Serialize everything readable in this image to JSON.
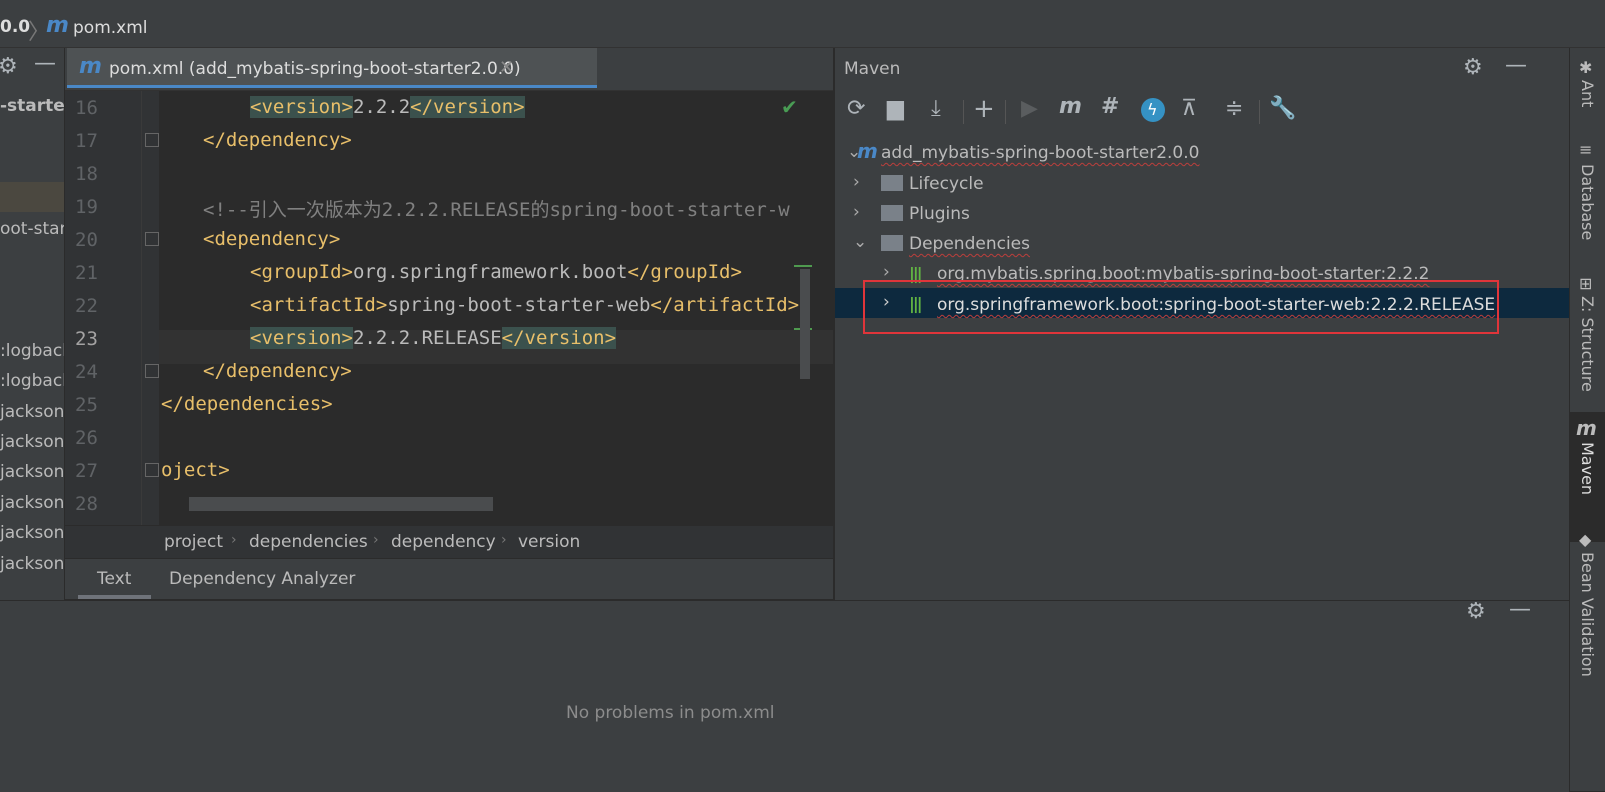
{
  "breadcrumb": {
    "version_frag": "0.0",
    "file": "pom.xml"
  },
  "left_panel": {
    "items": [
      "-starter",
      "oot-start",
      ":logback",
      ":logback",
      "jackson.c",
      "jackson.c",
      "jackson.c",
      "jackson.c",
      "jackson.c",
      "jackson.c"
    ]
  },
  "editor": {
    "tab_label": "pom.xml (add_mybatis-spring-boot-starter2.0.0)",
    "lines": [
      {
        "num": "16",
        "t1": "<version>",
        "t2": "2.2.2",
        "t3": "</version>"
      },
      {
        "num": "17",
        "t1": "</dependency>"
      },
      {
        "num": "18"
      },
      {
        "num": "19",
        "comment": "<!--引入一次版本为2.2.2.RELEASE的spring-boot-starter-w"
      },
      {
        "num": "20",
        "t1": "<dependency>"
      },
      {
        "num": "21",
        "t1": "<groupId>",
        "t2": "org.springframework.boot",
        "t3": "</groupId>"
      },
      {
        "num": "22",
        "t1": "<artifactId>",
        "t2": "spring-boot-starter-web",
        "t3": "</artifactId>"
      },
      {
        "num": "23",
        "t1": "<version>",
        "t2": "2.2.2.RELEASE",
        "t3": "</version>"
      },
      {
        "num": "24",
        "t1": "</dependency>"
      },
      {
        "num": "25",
        "t1": "</dependencies>"
      },
      {
        "num": "26"
      },
      {
        "num": "27",
        "t1": "oject>"
      },
      {
        "num": "28"
      }
    ],
    "crumbs": [
      "project",
      "dependencies",
      "dependency",
      "version"
    ],
    "bottom_tabs": [
      "Text",
      "Dependency Analyzer"
    ]
  },
  "maven": {
    "title": "Maven",
    "project": "add_mybatis-spring-boot-starter2.0.0",
    "lifecycle": "Lifecycle",
    "plugins": "Plugins",
    "dependencies": "Dependencies",
    "dep1": "org.mybatis.spring.boot:mybatis-spring-boot-starter:2.2.2",
    "dep2": "org.springframework.boot:spring-boot-starter-web:2.2.2.RELEASE",
    "highlight_color": "#e0353a"
  },
  "problems": {
    "message": "No problems in pom.xml"
  },
  "right_strip": {
    "labels": [
      "Ant",
      "Database",
      "Z: Structure",
      "Maven",
      "Bean Validation"
    ]
  },
  "colors": {
    "selection": "#0d293e",
    "tag": "#e8bf6a",
    "accent": "#4a88c7"
  }
}
